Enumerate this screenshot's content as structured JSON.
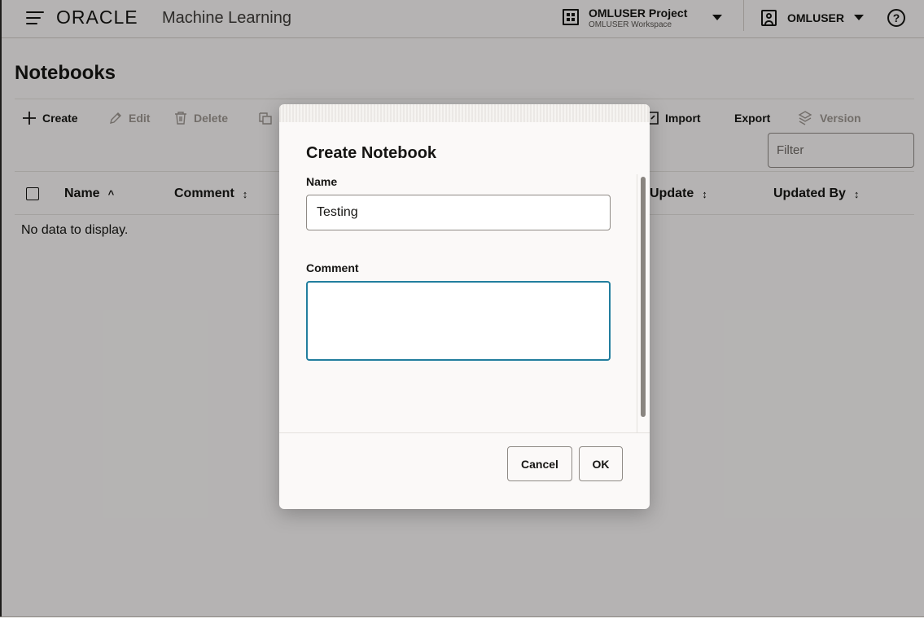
{
  "header": {
    "brand": "ORACLE",
    "app_name": "Machine Learning",
    "project_name": "OMLUSER Project",
    "workspace_name": "OMLUSER Workspace",
    "user_name": "OMLUSER",
    "help_symbol": "?"
  },
  "page": {
    "title": "Notebooks"
  },
  "toolbar": {
    "create_label": "Create",
    "edit_label": "Edit",
    "delete_label": "Delete",
    "import_label": "Import",
    "export_label": "Export",
    "version_label": "Version",
    "filter_placeholder": "Filter"
  },
  "table": {
    "columns": [
      "Name",
      "Comment",
      "Update",
      "Updated By"
    ],
    "sort_indicators": [
      "^",
      "↕",
      "↕",
      "↕"
    ],
    "empty_message": "No data to display."
  },
  "dialog": {
    "title": "Create Notebook",
    "name_label": "Name",
    "name_value": "Testing",
    "comment_label": "Comment",
    "comment_value": "",
    "cancel_label": "Cancel",
    "ok_label": "OK"
  },
  "colors": {
    "focus_ring": "#227e9e",
    "text": "#161513",
    "disabled_text": "#9e9892"
  },
  "icons": [
    "menu-icon",
    "project-grid-icon",
    "user-icon",
    "help-icon",
    "plus-icon",
    "pencil-icon",
    "trash-icon",
    "copy-icon",
    "import-icon",
    "version-icon",
    "chevron-down-icon"
  ]
}
